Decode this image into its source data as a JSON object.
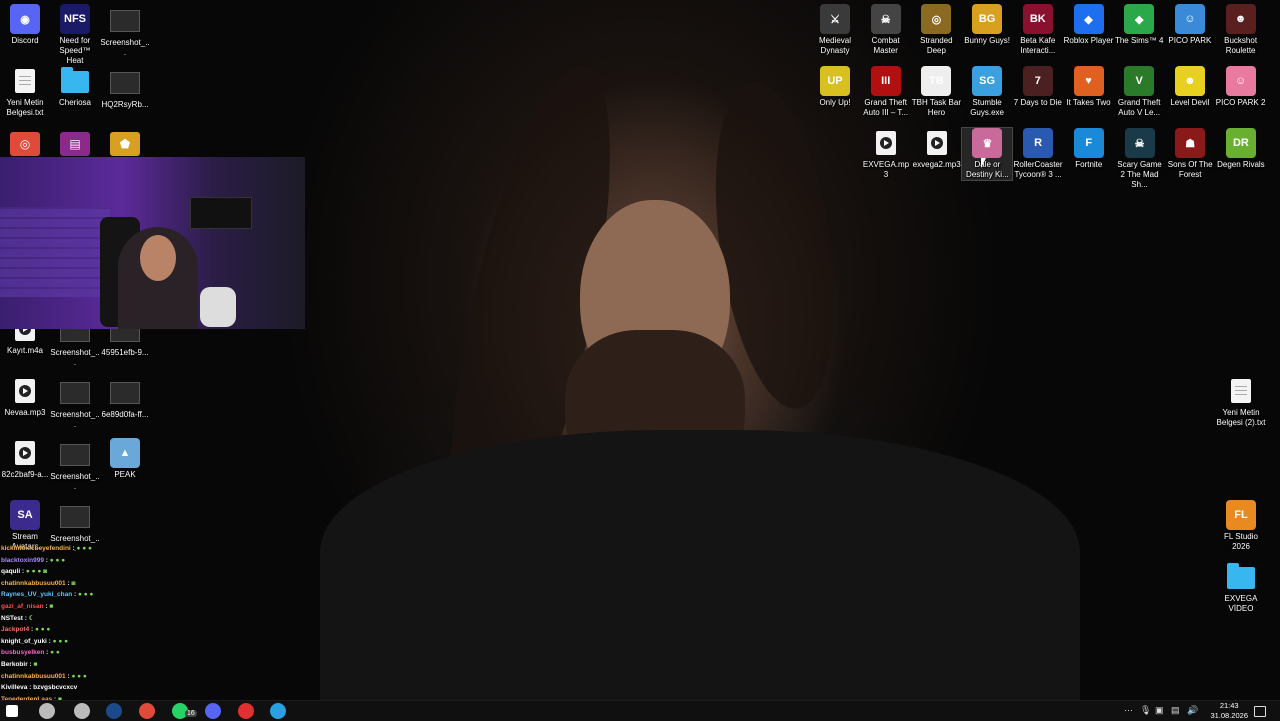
{
  "desktop_left": [
    {
      "label": "Discord",
      "kind": "app",
      "color": "#5865f2",
      "glyph": "◉"
    },
    {
      "label": "Need for Speed™ Heat",
      "kind": "app",
      "color": "#1a1a66",
      "glyph": "NFS"
    },
    {
      "label": "Screenshot_...",
      "kind": "shot"
    },
    {
      "label": "Yeni Metin Belgesi.txt",
      "kind": "doc"
    },
    {
      "label": "Cheriosa",
      "kind": "folder"
    },
    {
      "label": "HQ2RsyRb...",
      "kind": "shot"
    },
    {
      "label": "Kayıt.m4a",
      "kind": "play"
    },
    {
      "label": "Screenshot_...",
      "kind": "shot"
    },
    {
      "label": "45951efb-9...",
      "kind": "shot"
    },
    {
      "label": "Nevaa.mp3",
      "kind": "play"
    },
    {
      "label": "Screenshot_...",
      "kind": "shot"
    },
    {
      "label": "6e89d0fa-ff...",
      "kind": "shot"
    },
    {
      "label": "82c2baf9-a...",
      "kind": "play"
    },
    {
      "label": "Screenshot_...",
      "kind": "shot"
    },
    {
      "label": "PEAK",
      "kind": "app",
      "color": "#6aa8d8",
      "glyph": "▲"
    },
    {
      "label": "Stream Avatars",
      "kind": "app",
      "color": "#3b2b8c",
      "glyph": "SA"
    },
    {
      "label": "Screenshot_...",
      "kind": "shot"
    }
  ],
  "desktop_right": [
    {
      "label": "Medieval Dynasty",
      "color": "#3a3a3a",
      "glyph": "⚔"
    },
    {
      "label": "Combat Master",
      "color": "#444",
      "glyph": "☠"
    },
    {
      "label": "Stranded Deep",
      "color": "#8a6a20",
      "glyph": "◎"
    },
    {
      "label": "Bunny Guys!",
      "color": "#d8a020",
      "glyph": "BG"
    },
    {
      "label": "Beta Kafe Interacti...",
      "color": "#8a1030",
      "glyph": "BK"
    },
    {
      "label": "Roblox Player",
      "color": "#1e6ef0",
      "glyph": "◆"
    },
    {
      "label": "The Sims™ 4",
      "color": "#2aa84a",
      "glyph": "◆"
    },
    {
      "label": "PICO PARK",
      "color": "#3a8ad8",
      "glyph": "☺"
    },
    {
      "label": "Buckshot Roulette",
      "color": "#5a2020",
      "glyph": "☻"
    },
    {
      "label": "Only Up!",
      "color": "#d8c020",
      "glyph": "UP"
    },
    {
      "label": "Grand Theft Auto III – T...",
      "color": "#b01010",
      "glyph": "III"
    },
    {
      "label": "TBH Task Bar Hero",
      "color": "#eee",
      "glyph": "TB"
    },
    {
      "label": "Stumble Guys.exe",
      "color": "#3aa0e0",
      "glyph": "SG"
    },
    {
      "label": "7 Days to Die",
      "color": "#4a2020",
      "glyph": "7"
    },
    {
      "label": "It Takes Two",
      "color": "#e06020",
      "glyph": "♥"
    },
    {
      "label": "Grand Theft Auto V Le...",
      "color": "#2a7a2a",
      "glyph": "V"
    },
    {
      "label": "Level Devil",
      "color": "#e8d020",
      "glyph": "☻"
    },
    {
      "label": "PICO PARK 2",
      "color": "#e87aa0",
      "glyph": "☺"
    },
    {
      "label": "EXVEGA.mp3",
      "color": "",
      "glyph": "play"
    },
    {
      "label": "exvega2.mp3",
      "color": "",
      "glyph": "play"
    },
    {
      "label": "Dale or Destiny Ki...",
      "color": "#c86a9a",
      "glyph": "♛"
    },
    {
      "label": "RollerCoaster Tycoon® 3 ...",
      "color": "#2a5ab0",
      "glyph": "R"
    },
    {
      "label": "Fortnite",
      "color": "#1a8ad8",
      "glyph": "F"
    },
    {
      "label": "Scary Game 2 The Mad Sh...",
      "color": "#1a3a4a",
      "glyph": "☠"
    },
    {
      "label": "Sons Of The Forest",
      "color": "#8a1a1a",
      "glyph": "☗"
    },
    {
      "label": "Degen Rivals",
      "color": "#6ab030",
      "glyph": "DR"
    }
  ],
  "desktop_right_lower": [
    {
      "label": "Yeni Metin Belgesi (2).txt",
      "kind": "doc"
    },
    {
      "label": "FL Studio 2026",
      "kind": "app",
      "color": "#e88a20",
      "glyph": "FL"
    },
    {
      "label": "EXVEGA VİDEO",
      "kind": "folder"
    }
  ],
  "chat": [
    {
      "user": "kickintoxicbeyefendini",
      "color": "#ffb347",
      "msg": "",
      "emotes": "● ● ●"
    },
    {
      "user": "blacktoxin999",
      "color": "#a98bff",
      "msg": "",
      "emotes": "● ● ●"
    },
    {
      "user": "qaquli",
      "color": "#ffffff",
      "msg": "",
      "emotes": "● ● ● ◙"
    },
    {
      "user": "chatinnkabbusuu001",
      "color": "#ffb347",
      "msg": "",
      "emotes": "◙"
    },
    {
      "user": "Raynes_UV_yuki_chan",
      "color": "#5fc8ff",
      "msg": "",
      "emotes": "● ● ●"
    },
    {
      "user": "gazi_af_nisan",
      "color": "#ff4d4d",
      "msg": "",
      "emotes": "■"
    },
    {
      "user": "NSTest",
      "color": "#ffffff",
      "msg": "",
      "emotes": "☾"
    },
    {
      "user": "Jackpot4",
      "color": "#ff6b6b",
      "msg": "",
      "emotes": "● ● ●"
    },
    {
      "user": "knight_of_yuki",
      "color": "#ffffff",
      "msg": "",
      "emotes": "● ● ●"
    },
    {
      "user": "busbusyelken",
      "color": "#ff66cc",
      "msg": "",
      "emotes": "● ●"
    },
    {
      "user": "Berkobir",
      "color": "#ffffff",
      "msg": "",
      "emotes": "■"
    },
    {
      "user": "chatinnkabbusuu001",
      "color": "#ffb347",
      "msg": "",
      "emotes": "● ● ●"
    },
    {
      "user": "Kivilleva",
      "color": "#ffffff",
      "msg": "bzvgsbcvcxcv",
      "emotes": ""
    },
    {
      "user": "TepederdenLaas",
      "color": "#ffb347",
      "msg": "",
      "emotes": "■"
    }
  ],
  "taskbar": {
    "badge": "16",
    "time": "21:43",
    "date": "31.08.2026",
    "apps": [
      {
        "name": "start-button",
        "color": "#ffffff"
      },
      {
        "name": "search-button",
        "color": "#bbbbbb"
      },
      {
        "name": "settings-app",
        "color": "#bbbbbb"
      },
      {
        "name": "steam-app",
        "color": "#1b4a8a"
      },
      {
        "name": "chrome-app",
        "color": "#e04a3a"
      },
      {
        "name": "whatsapp-app",
        "color": "#25d366"
      },
      {
        "name": "discord-app",
        "color": "#5865f2"
      },
      {
        "name": "recorder-app",
        "color": "#e03030"
      },
      {
        "name": "telegram-app",
        "color": "#2aa0e0"
      }
    ]
  }
}
